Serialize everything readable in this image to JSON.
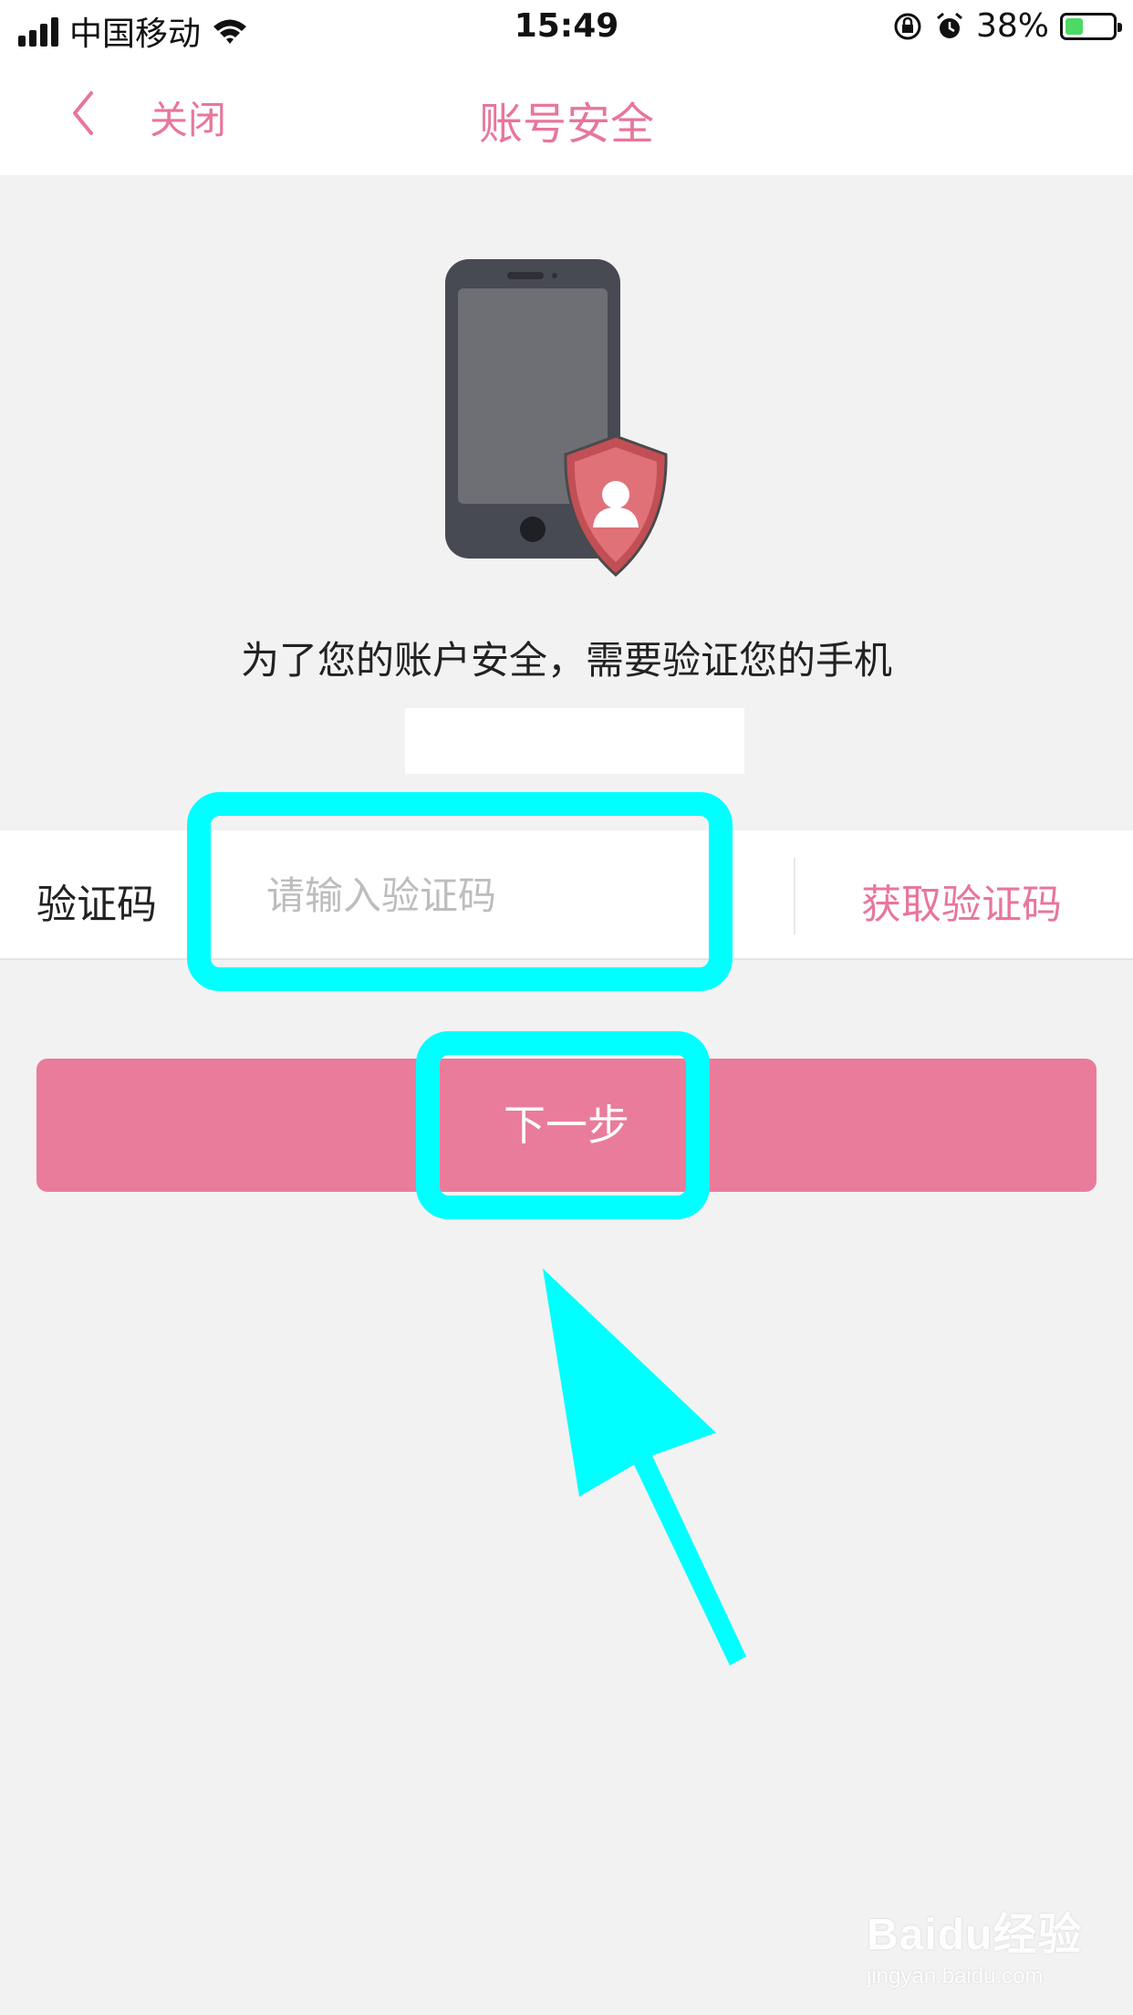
{
  "status_bar": {
    "carrier": "中国移动",
    "time": "15:49",
    "battery_percent": "38%",
    "battery_level": 0.38,
    "icons": [
      "signal-icon",
      "wifi-icon",
      "rotation-lock-icon",
      "alarm-icon",
      "battery-icon"
    ]
  },
  "nav": {
    "back_icon": "chevron-left-icon",
    "close_label": "关闭",
    "title": "账号安全"
  },
  "illustration": {
    "icons": [
      "phone-icon",
      "shield-user-icon"
    ]
  },
  "verify": {
    "message": "为了您的账户安全，需要验证您的手机",
    "code_label": "验证码",
    "code_placeholder": "请输入验证码",
    "code_value": "",
    "get_code_label": "获取验证码"
  },
  "next_button_label": "下一步",
  "colors": {
    "accent": "#e8769a",
    "button": "#e97c9b",
    "highlight": "#00ffff",
    "background": "#f2f2f2"
  },
  "watermark": {
    "logo": "Baidu经验",
    "url": "jingyan.baidu.com"
  }
}
